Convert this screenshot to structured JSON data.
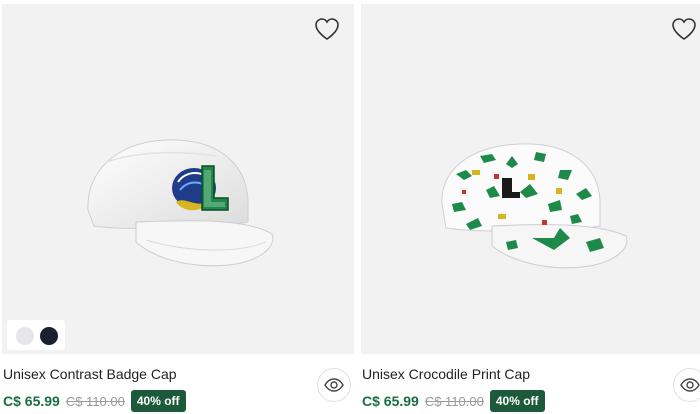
{
  "colors": {
    "media_bg": "#f2f2f2",
    "price": "#1a6e44",
    "badge_bg": "#1d5a3c",
    "swatch_white": "#e6e6ea",
    "swatch_navy": "#1b1f2e",
    "print_green": "#1e8a4a"
  },
  "products": [
    {
      "name": "Unisex Contrast Badge Cap",
      "price": "C$ 65.99",
      "original_price": "C$ 110.00",
      "discount": "40% off",
      "wishlist_icon": "heart-outline-icon",
      "quickview_icon": "eye-icon",
      "swatches": [
        "white",
        "navy"
      ]
    },
    {
      "name": "Unisex Crocodile Print Cap",
      "price": "C$ 65.99",
      "original_price": "C$ 110.00",
      "discount": "40% off",
      "wishlist_icon": "heart-outline-icon",
      "quickview_icon": "eye-icon"
    }
  ]
}
